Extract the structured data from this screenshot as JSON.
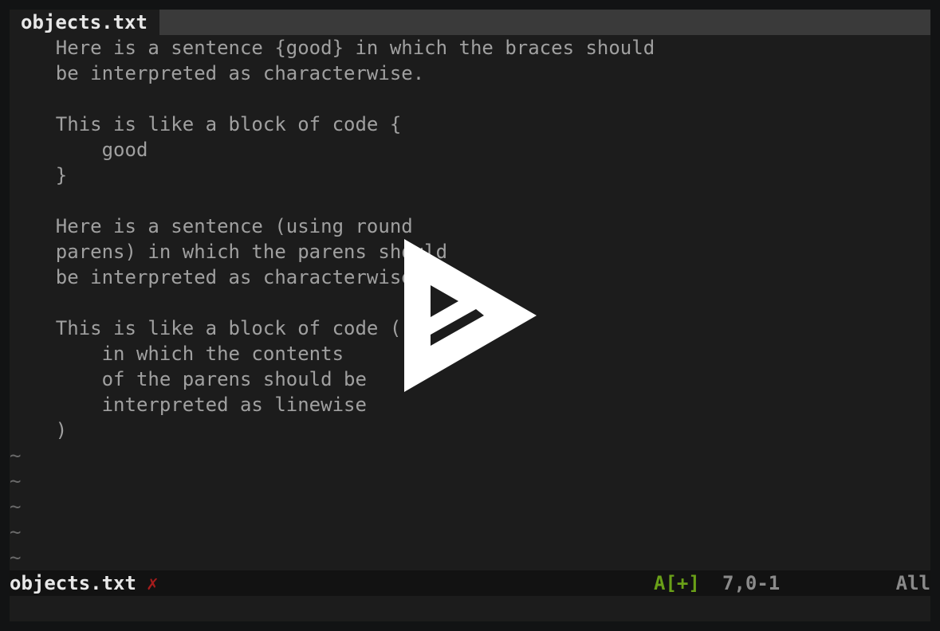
{
  "tabline": {
    "tab_label": "objects.txt"
  },
  "buffer": {
    "lines": [
      "    Here is a sentence {good} in which the braces should",
      "    be interpreted as characterwise.",
      "",
      "    This is like a block of code {",
      "        good",
      "    }",
      "",
      "    Here is a sentence (using round",
      "    parens) in which the parens should",
      "    be interpreted as characterwise.",
      "",
      "    This is like a block of code (",
      "        in which the contents",
      "        of the parens should be",
      "        interpreted as linewise",
      "    )"
    ],
    "tildes": [
      "~",
      "~",
      "~",
      "~",
      "~"
    ]
  },
  "statusline": {
    "filename": "objects.txt",
    "modified_flag": "✗",
    "mode": "A[+]",
    "position": "7,0-1",
    "scroll": "All"
  },
  "colors": {
    "background": "#1c1c1c",
    "text": "#a0a0a0",
    "mode_green": "#6aa018",
    "flag_red": "#a51c1c"
  },
  "overlay": {
    "icon": "asciinema-play-icon"
  }
}
